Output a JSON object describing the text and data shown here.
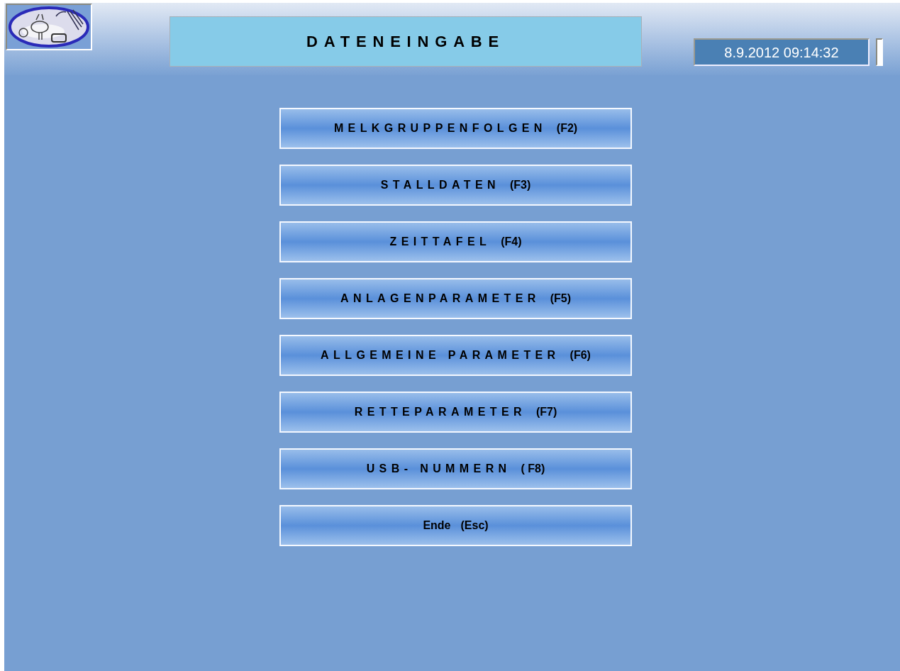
{
  "title": "DATENEINGABE",
  "datetime": "8.9.2012 09:14:32",
  "menu": [
    {
      "label": "MELKGRUPPENFOLGEN",
      "key": "(F2)",
      "kind": "function"
    },
    {
      "label": "STALLDATEN",
      "key": "(F3)",
      "kind": "function"
    },
    {
      "label": "ZEITTAFEL",
      "key": "(F4)",
      "kind": "function"
    },
    {
      "label": "ANLAGENPARAMETER",
      "key": "(F5)",
      "kind": "function"
    },
    {
      "label": "ALLGEMEINE PARAMETER",
      "key": "(F6)",
      "kind": "function"
    },
    {
      "label": "RETTEPARAMETER",
      "key": "(F7)",
      "kind": "function"
    },
    {
      "label": "USB- NUMMERN",
      "key": "( F8)",
      "kind": "function"
    },
    {
      "label": "Ende",
      "key": "(Esc)",
      "kind": "exit"
    }
  ]
}
